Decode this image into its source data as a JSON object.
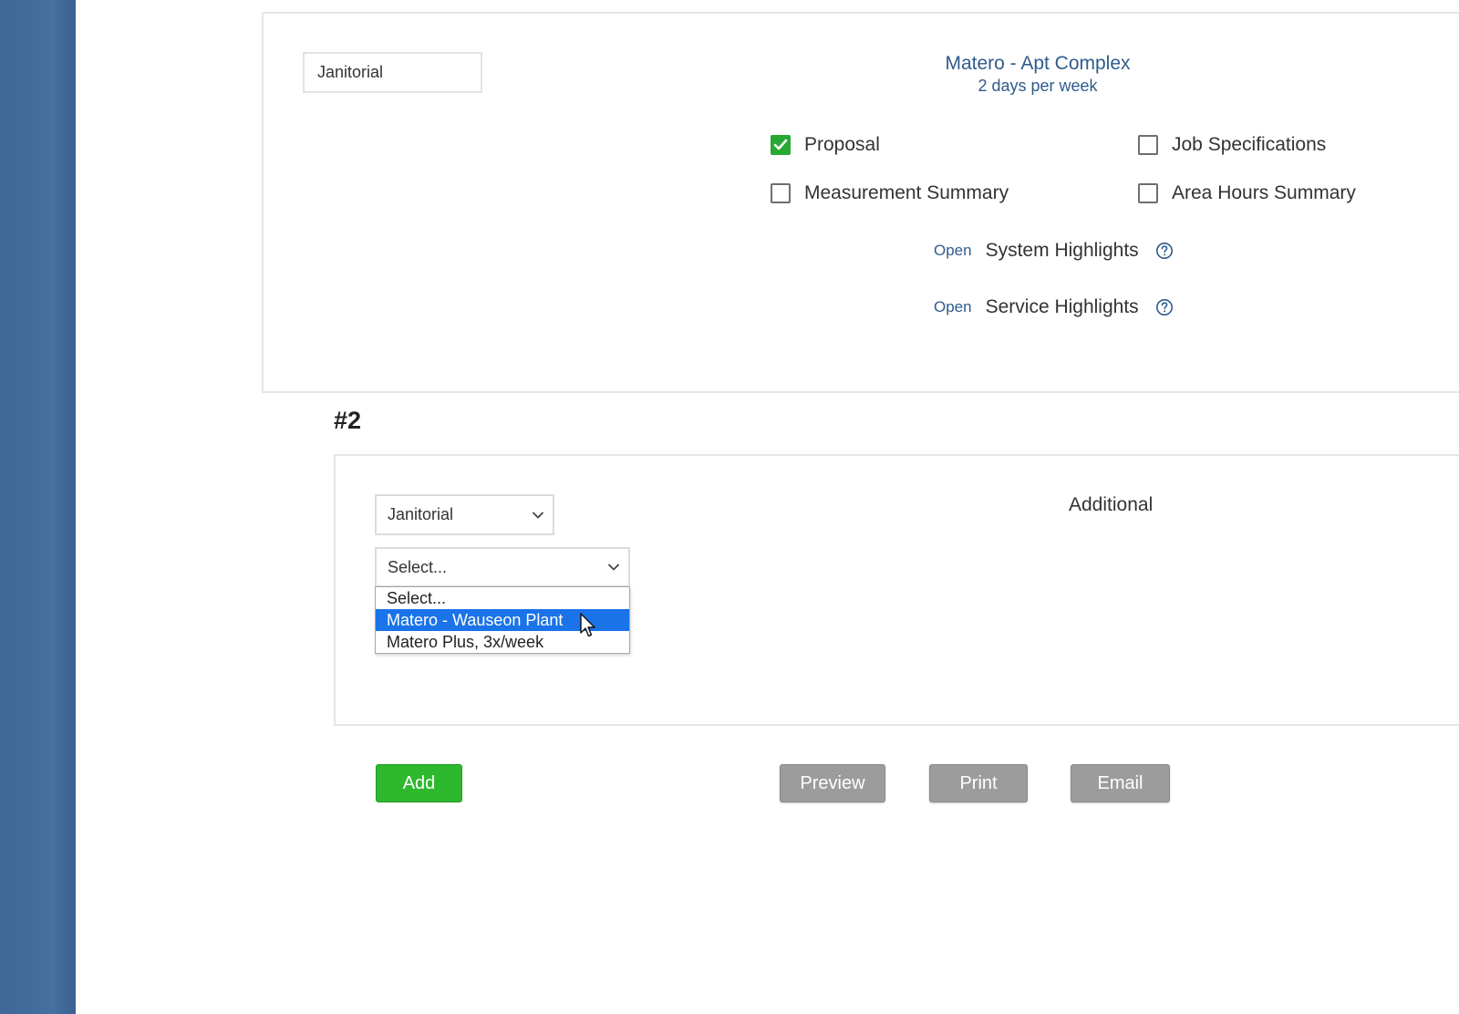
{
  "card1": {
    "service_field_value": "Janitorial",
    "site_title": "Matero - Apt Complex",
    "frequency": "2 days per week",
    "checkboxes": [
      {
        "label": "Proposal",
        "checked": true
      },
      {
        "label": "Job Specifications",
        "checked": false
      },
      {
        "label": "Measurement Summary",
        "checked": false
      },
      {
        "label": "Area Hours Summary",
        "checked": false
      }
    ],
    "highlights": [
      {
        "link": "Open",
        "label": "System Highlights",
        "icon": "help-circle-icon"
      },
      {
        "link": "Open",
        "label": "Service Highlights",
        "icon": "help-circle-icon"
      }
    ]
  },
  "section2": {
    "number": "#2",
    "service_select": {
      "selected": "Janitorial"
    },
    "template_select": {
      "selected": "Select...",
      "options": [
        "Select...",
        "Matero - Wauseon Plant",
        "Matero Plus, 3x/week"
      ],
      "highlighted_index": 1
    },
    "additional_label": "Additional"
  },
  "actions": {
    "add": "Add",
    "preview": "Preview",
    "print": "Print",
    "email": "Email"
  },
  "colors": {
    "sidebar": "#44709e",
    "accent_blue_text": "#2f5b8c",
    "check_green": "#26a832",
    "add_green": "#2eb82e",
    "button_gray": "#9c9c9c",
    "option_highlight": "#1a73e8"
  }
}
